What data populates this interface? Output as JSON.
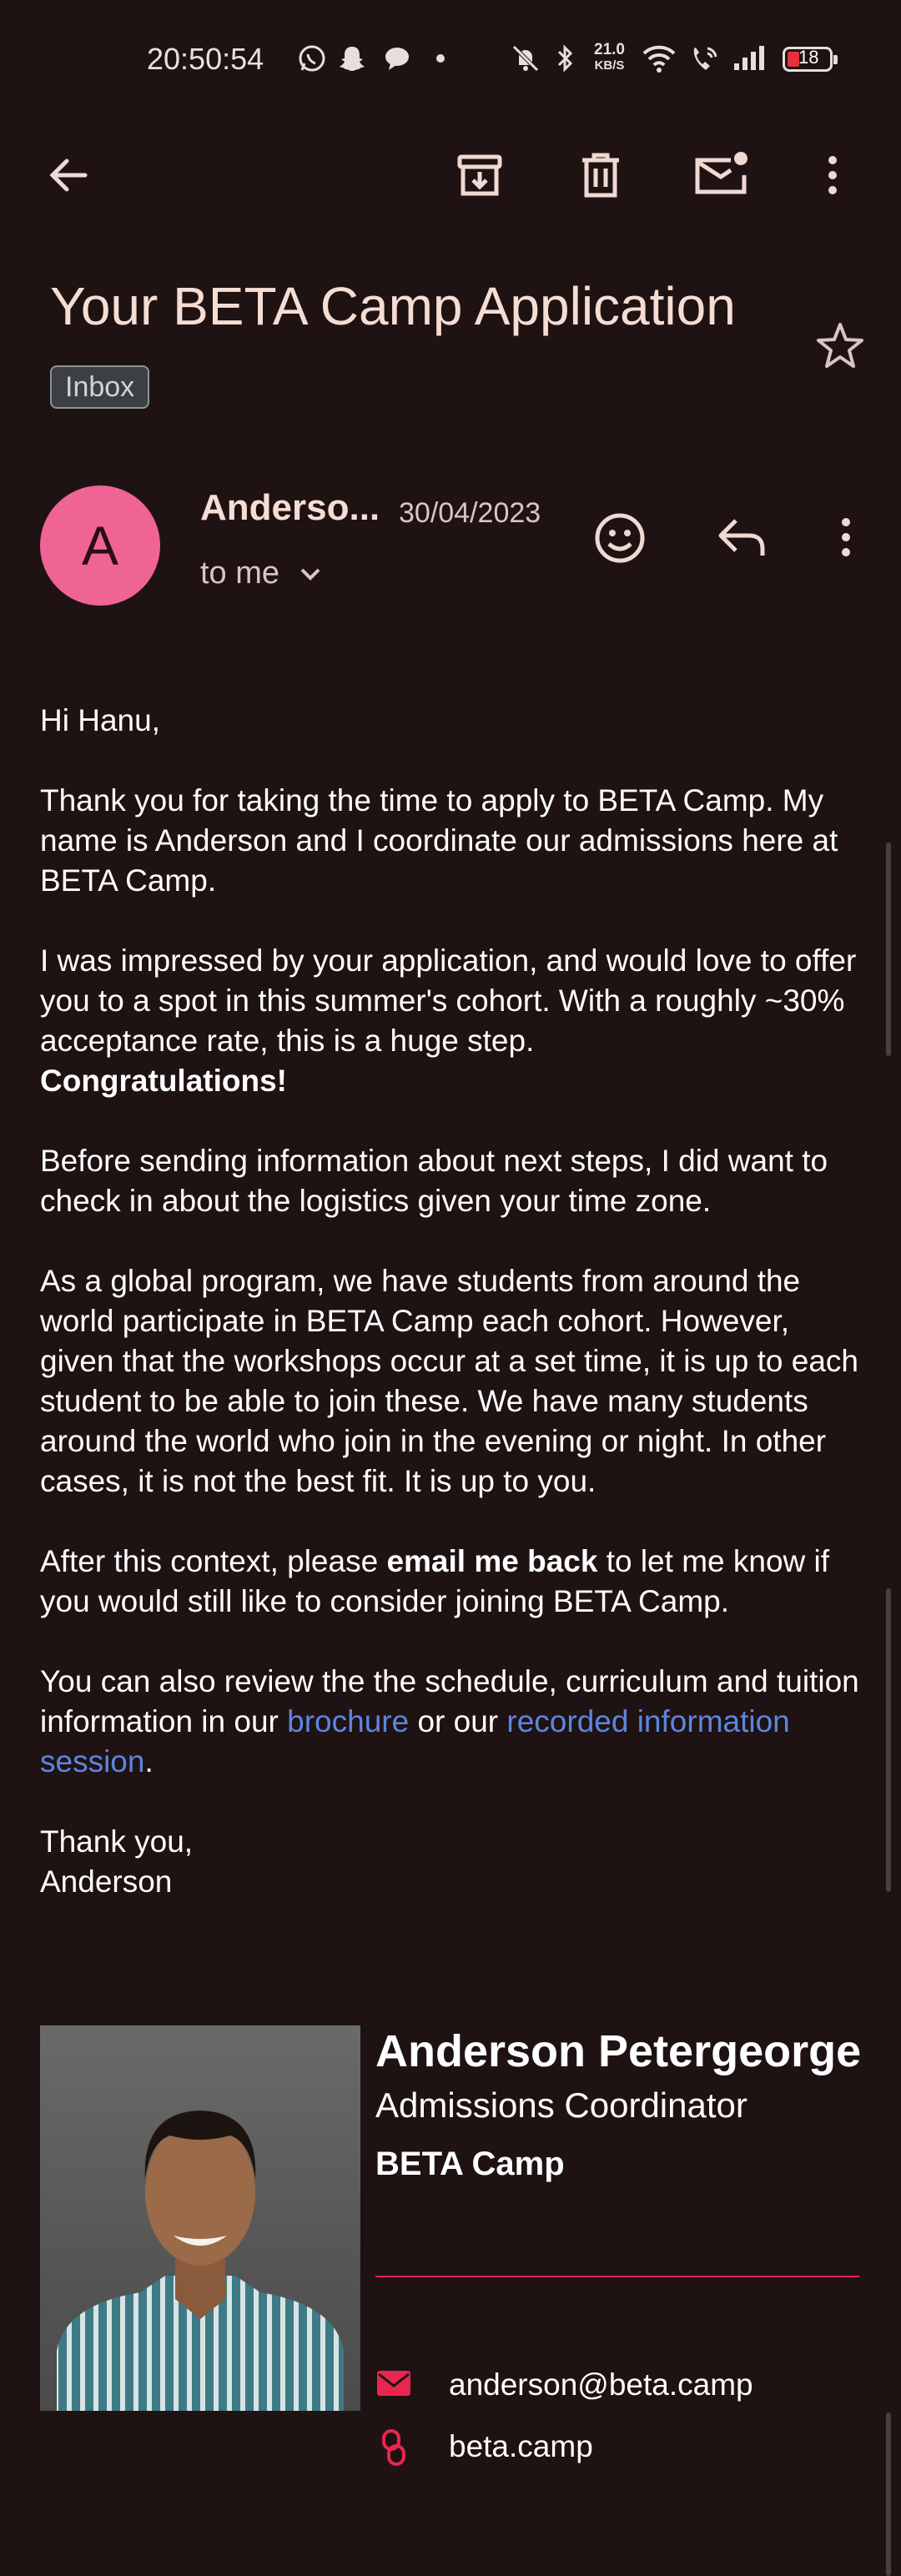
{
  "status_bar": {
    "time": "20:50:54",
    "speed_value": "21.0",
    "speed_unit": "KB/S",
    "battery": "18",
    "icons": [
      "whatsapp-icon",
      "snapchat-icon",
      "chat-bubble-icon",
      "dot-icon",
      "mute-icon",
      "bluetooth-icon",
      "wifi-icon",
      "wifi-call-icon",
      "signal-icon",
      "battery-icon"
    ]
  },
  "toolbar": {
    "icons": [
      "back-arrow-icon",
      "archive-icon",
      "delete-icon",
      "mark-unread-icon",
      "more-vert-icon"
    ]
  },
  "email": {
    "subject": "Your BETA Camp Application",
    "label": "Inbox",
    "avatar_letter": "A",
    "sender": "Anderso...",
    "date": "30/04/2023",
    "recipient": "to me"
  },
  "body": {
    "greeting": "Hi Hanu,",
    "p1": "Thank you for taking the time to apply to BETA Camp. My name is Anderson and I coordinate our admissions here at BETA Camp.",
    "p2": "I was impressed by your application, and would love to offer you to a spot in this summer's cohort. With a roughly ~30% acceptance rate, this is a huge step.",
    "p2_bold": "Congratulations!",
    "p3": "Before sending information about next steps, I did want to check in about the logistics given your time zone.",
    "p4": "As a global program, we have students from around the world participate in BETA Camp each cohort. However, given that the workshops occur at a set time, it is up to each student to be able to join these. We have many students around the world who join in the evening or night. In other cases, it is not the best fit. It is up to you.",
    "p5_a": "After this context, please ",
    "p5_bold": "email me back",
    "p5_b": " to let me know if you would still like to consider joining BETA Camp.",
    "p6_a": "You can also review the the schedule, curriculum and tuition information in our ",
    "p6_link1": "brochure",
    "p6_mid": " or our ",
    "p6_link2": "recorded information session",
    "p6_end": ".",
    "closing": "Thank you,",
    "closing_name": "Anderson"
  },
  "signature": {
    "name": "Anderson Petergeorge",
    "title": "Admissions Coordinator",
    "org": "BETA Camp",
    "email": "anderson@beta.camp",
    "website": "beta.camp",
    "accent_color": "#e8264f"
  },
  "colors": {
    "background": "#1f1212",
    "avatar": "#ef6495",
    "link": "#5b86e0"
  }
}
